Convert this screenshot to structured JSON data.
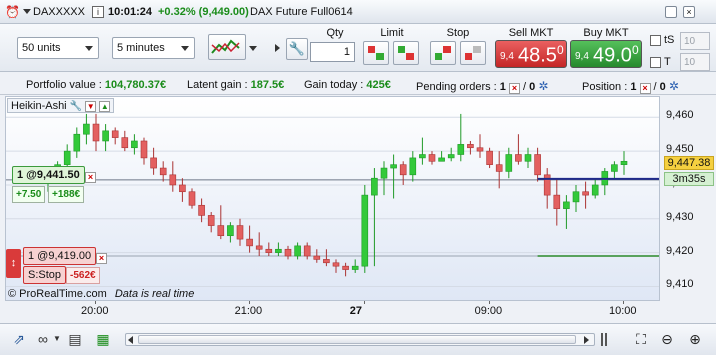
{
  "titlebar": {
    "symbol": "DAXXXXX",
    "time": "10:01:24",
    "change": "+0.32% (9,449.00)",
    "instrument": "DAX Future Full0614"
  },
  "tradebar": {
    "units": "50 units",
    "interval": "5 minutes",
    "qty_label": "Qty",
    "qty_value": "1",
    "limit_label": "Limit",
    "stop_label": "Stop",
    "sell_label": "Sell MKT",
    "sell_small": "9,4",
    "sell_big": "48.5",
    "sell_sup": "0",
    "buy_label": "Buy MKT",
    "buy_small": "9,4",
    "buy_big": "49.0",
    "buy_sup": "0",
    "ts_label": "tS",
    "t_label": "T",
    "ts_value": "10",
    "t_value": "10"
  },
  "status": {
    "portfolio_label": "Portfolio value :",
    "portfolio_value": "104,780.37€",
    "latent_label": "Latent gain :",
    "latent_value": "187.5€",
    "today_label": "Gain today :",
    "today_value": "425€",
    "pending_label": "Pending orders :",
    "pending_a": "1",
    "pending_b": "0",
    "position_label": "Position :",
    "position_a": "1",
    "position_b": "0"
  },
  "chart": {
    "indicator_label": "Heikin-Ashi",
    "price_label": "9,447.38",
    "countdown": "3m35s",
    "watermark": "© ProRealTime.com",
    "watermark_note": "Data is real time",
    "position_line_label": "1 @9,441.50",
    "position_pnl_pts": "+7.50",
    "position_pnl_eur": "+188€",
    "stop_line_label": "1 @9,419.00",
    "stop_type": "S:Stop",
    "stop_pnl": "-562€"
  },
  "colors": {
    "up": "#33c93a",
    "down": "#e36060",
    "position_line": "#1f2a8a",
    "stop_line": "#2a8a2a",
    "sell_bg": "#d93a3a",
    "buy_bg": "#2e9e36"
  },
  "chart_data": {
    "type": "candlestick",
    "ylim": [
      9406,
      9466
    ],
    "y_ticks": [
      9410,
      9420,
      9430,
      9440,
      9450,
      9460
    ],
    "y_tick_labels": [
      "9,410",
      "9,420",
      "9,430",
      "9,440",
      "9,450",
      "9,460"
    ],
    "x_tick_labels": [
      "20:00",
      "21:00",
      "27",
      "09:00",
      "10:00"
    ],
    "reference_lines": [
      {
        "label": "1 @9,441.50",
        "y": 9441.5
      },
      {
        "label": "1 @9,419.00",
        "y": 9419.0
      }
    ],
    "candles": [
      {
        "o": 9441,
        "h": 9444,
        "l": 9438,
        "c": 9443
      },
      {
        "o": 9443,
        "h": 9447,
        "l": 9441,
        "c": 9446
      },
      {
        "o": 9446,
        "h": 9452,
        "l": 9444,
        "c": 9450
      },
      {
        "o": 9450,
        "h": 9457,
        "l": 9448,
        "c": 9455
      },
      {
        "o": 9455,
        "h": 9461,
        "l": 9452,
        "c": 9458
      },
      {
        "o": 9458,
        "h": 9461,
        "l": 9450,
        "c": 9453
      },
      {
        "o": 9453,
        "h": 9458,
        "l": 9450,
        "c": 9456
      },
      {
        "o": 9456,
        "h": 9457,
        "l": 9452,
        "c": 9454
      },
      {
        "o": 9454,
        "h": 9456,
        "l": 9450,
        "c": 9451
      },
      {
        "o": 9451,
        "h": 9455,
        "l": 9449,
        "c": 9453
      },
      {
        "o": 9453,
        "h": 9454,
        "l": 9446,
        "c": 9448
      },
      {
        "o": 9448,
        "h": 9451,
        "l": 9443,
        "c": 9445
      },
      {
        "o": 9445,
        "h": 9447,
        "l": 9441,
        "c": 9443
      },
      {
        "o": 9443,
        "h": 9447,
        "l": 9438,
        "c": 9440
      },
      {
        "o": 9440,
        "h": 9442,
        "l": 9435,
        "c": 9438
      },
      {
        "o": 9438,
        "h": 9439,
        "l": 9433,
        "c": 9434
      },
      {
        "o": 9434,
        "h": 9436,
        "l": 9429,
        "c": 9431
      },
      {
        "o": 9431,
        "h": 9432,
        "l": 9426,
        "c": 9428
      },
      {
        "o": 9428,
        "h": 9434,
        "l": 9424,
        "c": 9425
      },
      {
        "o": 9425,
        "h": 9429,
        "l": 9423,
        "c": 9428
      },
      {
        "o": 9428,
        "h": 9430,
        "l": 9422,
        "c": 9424
      },
      {
        "o": 9424,
        "h": 9428,
        "l": 9420,
        "c": 9422
      },
      {
        "o": 9422,
        "h": 9426,
        "l": 9419,
        "c": 9421
      },
      {
        "o": 9421,
        "h": 9423,
        "l": 9419,
        "c": 9420
      },
      {
        "o": 9420,
        "h": 9423,
        "l": 9419,
        "c": 9421
      },
      {
        "o": 9421,
        "h": 9422,
        "l": 9418,
        "c": 9419
      },
      {
        "o": 9419,
        "h": 9423,
        "l": 9418,
        "c": 9422
      },
      {
        "o": 9422,
        "h": 9423,
        "l": 9418,
        "c": 9419
      },
      {
        "o": 9419,
        "h": 9421,
        "l": 9417,
        "c": 9418
      },
      {
        "o": 9418,
        "h": 9421,
        "l": 9416,
        "c": 9417
      },
      {
        "o": 9417,
        "h": 9418,
        "l": 9414,
        "c": 9416
      },
      {
        "o": 9416,
        "h": 9417,
        "l": 9413,
        "c": 9415
      },
      {
        "o": 9415,
        "h": 9418,
        "l": 9414,
        "c": 9416
      },
      {
        "o": 9416,
        "h": 9440,
        "l": 9414,
        "c": 9437
      },
      {
        "o": 9437,
        "h": 9445,
        "l": 9416,
        "c": 9442
      },
      {
        "o": 9442,
        "h": 9447,
        "l": 9437,
        "c": 9445
      },
      {
        "o": 9445,
        "h": 9449,
        "l": 9436,
        "c": 9446
      },
      {
        "o": 9446,
        "h": 9447,
        "l": 9440,
        "c": 9443
      },
      {
        "o": 9443,
        "h": 9450,
        "l": 9441,
        "c": 9448
      },
      {
        "o": 9448,
        "h": 9454,
        "l": 9446,
        "c": 9449
      },
      {
        "o": 9449,
        "h": 9450,
        "l": 9446,
        "c": 9447
      },
      {
        "o": 9447,
        "h": 9450,
        "l": 9447,
        "c": 9448
      },
      {
        "o": 9448,
        "h": 9451,
        "l": 9447,
        "c": 9449
      },
      {
        "o": 9449,
        "h": 9461,
        "l": 9447,
        "c": 9452
      },
      {
        "o": 9452,
        "h": 9453,
        "l": 9449,
        "c": 9451
      },
      {
        "o": 9451,
        "h": 9455,
        "l": 9448,
        "c": 9450
      },
      {
        "o": 9450,
        "h": 9451,
        "l": 9445,
        "c": 9446
      },
      {
        "o": 9446,
        "h": 9450,
        "l": 9439,
        "c": 9444
      },
      {
        "o": 9444,
        "h": 9451,
        "l": 9442,
        "c": 9449
      },
      {
        "o": 9449,
        "h": 9455,
        "l": 9446,
        "c": 9447
      },
      {
        "o": 9447,
        "h": 9451,
        "l": 9445,
        "c": 9449
      },
      {
        "o": 9449,
        "h": 9451,
        "l": 9441,
        "c": 9443
      },
      {
        "o": 9443,
        "h": 9445,
        "l": 9433,
        "c": 9437
      },
      {
        "o": 9437,
        "h": 9442,
        "l": 9428,
        "c": 9433
      },
      {
        "o": 9433,
        "h": 9437,
        "l": 9427,
        "c": 9435
      },
      {
        "o": 9435,
        "h": 9440,
        "l": 9432,
        "c": 9438
      },
      {
        "o": 9438,
        "h": 9441,
        "l": 9433,
        "c": 9437
      },
      {
        "o": 9437,
        "h": 9442,
        "l": 9436,
        "c": 9440
      },
      {
        "o": 9440,
        "h": 9445,
        "l": 9437,
        "c": 9444
      },
      {
        "o": 9444,
        "h": 9447,
        "l": 9442,
        "c": 9446
      },
      {
        "o": 9446,
        "h": 9450,
        "l": 9443,
        "c": 9447
      }
    ]
  }
}
